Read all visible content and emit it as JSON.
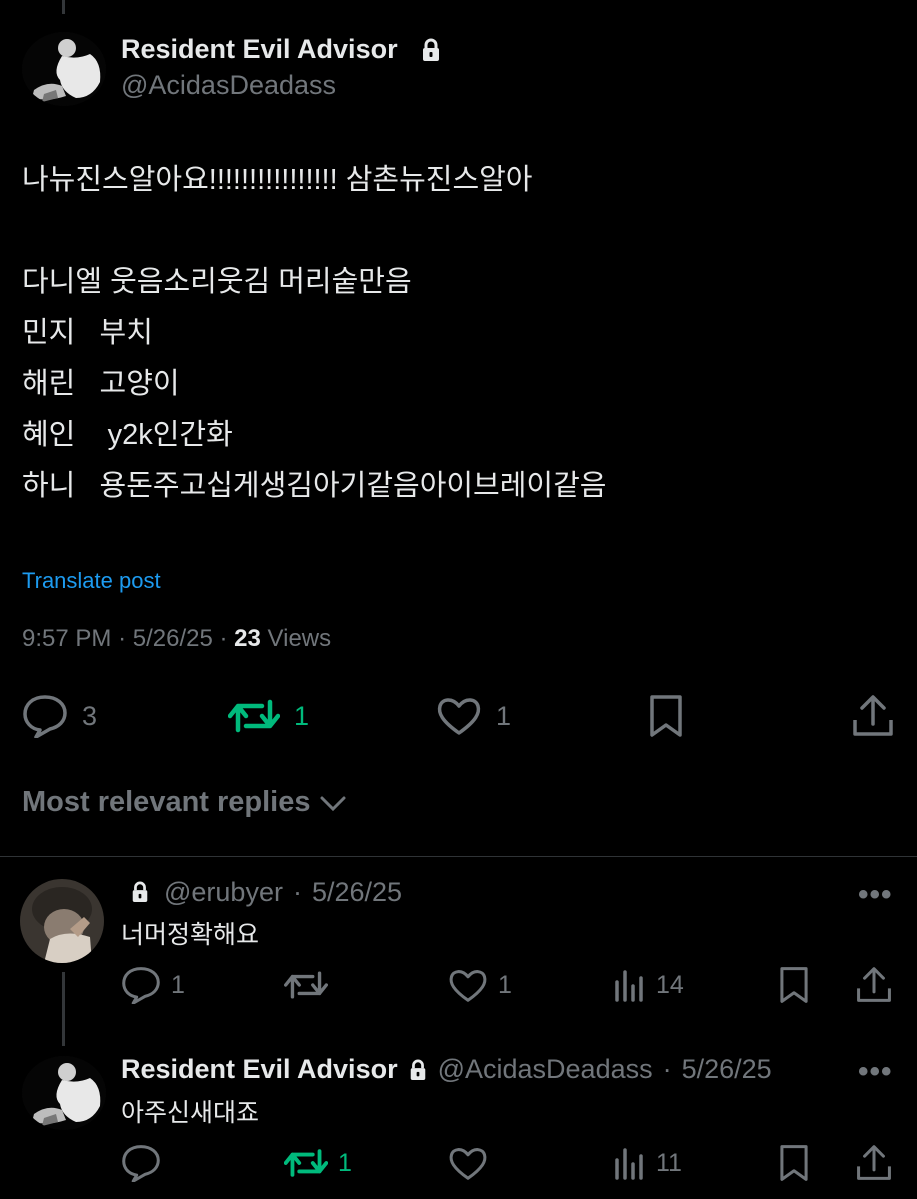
{
  "post": {
    "author_name": "Resident Evil Advisor",
    "author_handle": "@AcidasDeadass",
    "text": "나뉴진스알아요!!!!!!!!!!!!!!!! 삼촌뉴진스알아\n\n다니엘 웃음소리웃김 머리숱만음\n민지   부치\n해린   고양이\n혜인    y2k인간화\n하니   용돈주고십게생김아기같음아이브레이같음",
    "translate_label": "Translate post",
    "time": "9:57 PM",
    "date": "5/26/25",
    "views_count": "23",
    "views_label": "Views",
    "replies_count": "3",
    "reposts_count": "1",
    "likes_count": "1",
    "reposted_color": "#00ba7c"
  },
  "replies_sort_label": "Most relevant replies",
  "replies": [
    {
      "handle": "@erubyer",
      "date": "5/26/25",
      "text": "너머정확해요",
      "replies_count": "1",
      "reposts_count": "",
      "likes_count": "1",
      "views_count": "14"
    },
    {
      "author_name": "Resident Evil Advisor",
      "handle": "@AcidasDeadass",
      "date": "5/26/25",
      "text": "아주신새대죠",
      "replies_count": "",
      "reposts_count": "1",
      "likes_count": "",
      "views_count": "11"
    }
  ],
  "more_label": "•••",
  "dot_separator": "·"
}
